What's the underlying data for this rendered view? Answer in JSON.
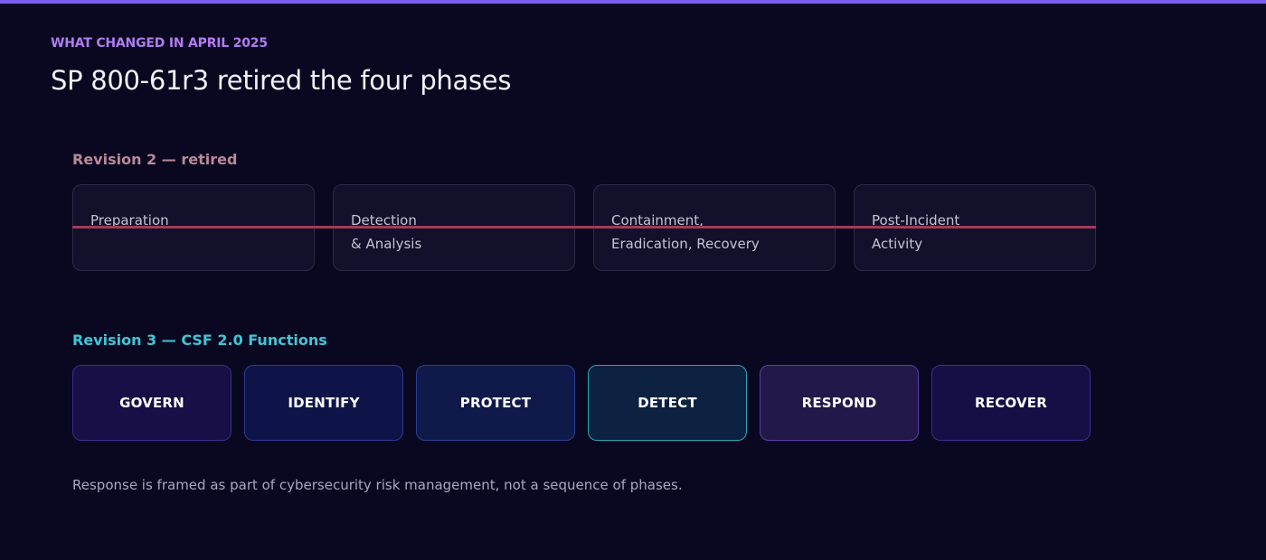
{
  "eyebrow": "WHAT CHANGED IN APRIL 2025",
  "title": "SP 800-61r3 retired the four phases",
  "revision2": {
    "label": "Revision 2 — retired",
    "phases": [
      {
        "line1": "Preparation",
        "line2": ""
      },
      {
        "line1": "Detection",
        "line2": "& Analysis"
      },
      {
        "line1": "Containment,",
        "line2": "Eradication, Recovery"
      },
      {
        "line1": "Post-Incident",
        "line2": "Activity"
      }
    ]
  },
  "revision3": {
    "label": "Revision 3 — CSF 2.0 Functions",
    "functions": [
      "GOVERN",
      "IDENTIFY",
      "PROTECT",
      "DETECT",
      "RESPOND",
      "RECOVER"
    ]
  },
  "note": "Response is framed as part of cybersecurity risk management, not a sequence of phases.",
  "colors": {
    "accent": "#7c5cf0",
    "eyebrow": "#b07cf0",
    "retired_label": "#b98a98",
    "strike": "#a23a5a",
    "csf_label": "#3fc6d6",
    "detect_border": "#2aa6b6"
  }
}
